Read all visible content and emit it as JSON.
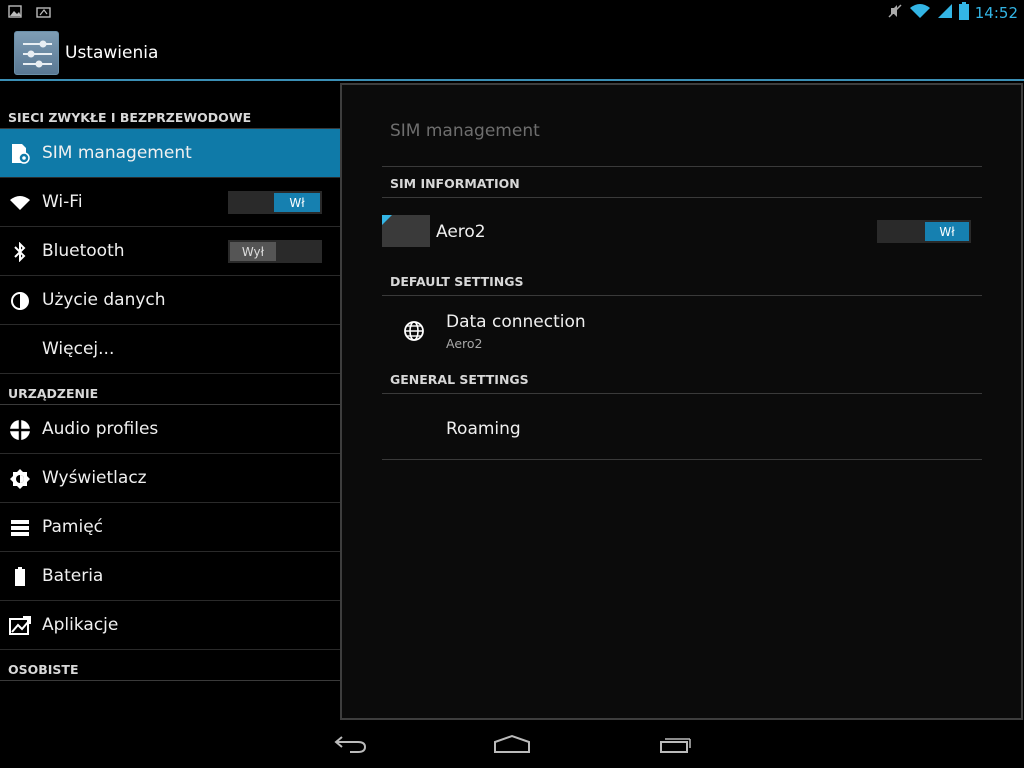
{
  "status_bar": {
    "left_icons": [
      "image-notification-icon",
      "screenshot-notification-icon"
    ],
    "right_icons": [
      "mute-icon",
      "wifi-icon",
      "signal-icon",
      "battery-icon"
    ],
    "time": "14:52"
  },
  "action_bar": {
    "icon": "settings-sliders-icon",
    "title": "Ustawienia"
  },
  "sidebar": {
    "sections": [
      {
        "header": "SIECI ZWYKŁE I BEZPRZEWODOWE",
        "items": [
          {
            "label": "SIM management",
            "icon": "sim-settings-icon",
            "selected": true
          },
          {
            "label": "Wi-Fi",
            "icon": "wifi-icon",
            "toggle": "Wł"
          },
          {
            "label": "Bluetooth",
            "icon": "bluetooth-icon",
            "toggle": "Wył"
          },
          {
            "label": "Użycie danych",
            "icon": "data-usage-icon"
          },
          {
            "label": "Więcej..."
          }
        ]
      },
      {
        "header": "URZĄDZENIE",
        "items": [
          {
            "label": "Audio profiles",
            "icon": "audio-profiles-icon"
          },
          {
            "label": "Wyświetlacz",
            "icon": "display-icon"
          },
          {
            "label": "Pamięć",
            "icon": "storage-icon"
          },
          {
            "label": "Bateria",
            "icon": "battery-icon"
          },
          {
            "label": "Aplikacje",
            "icon": "apps-icon"
          }
        ]
      },
      {
        "header": "OSOBISTE",
        "items": []
      }
    ]
  },
  "detail": {
    "title": "SIM management",
    "sim_information": {
      "header": "SIM INFORMATION",
      "sim_name": "Aero2",
      "toggle": "Wł"
    },
    "default_settings": {
      "header": "DEFAULT SETTINGS",
      "data_connection_label": "Data connection",
      "data_connection_value": "Aero2"
    },
    "general_settings": {
      "header": "GENERAL SETTINGS",
      "roaming_label": "Roaming"
    }
  },
  "nav_bar": {
    "buttons": [
      "back-icon",
      "home-icon",
      "recent-apps-icon"
    ]
  },
  "colors": {
    "accent": "#33b5e5",
    "selected": "#0f7aa8",
    "toggle_on": "#1680b0"
  }
}
